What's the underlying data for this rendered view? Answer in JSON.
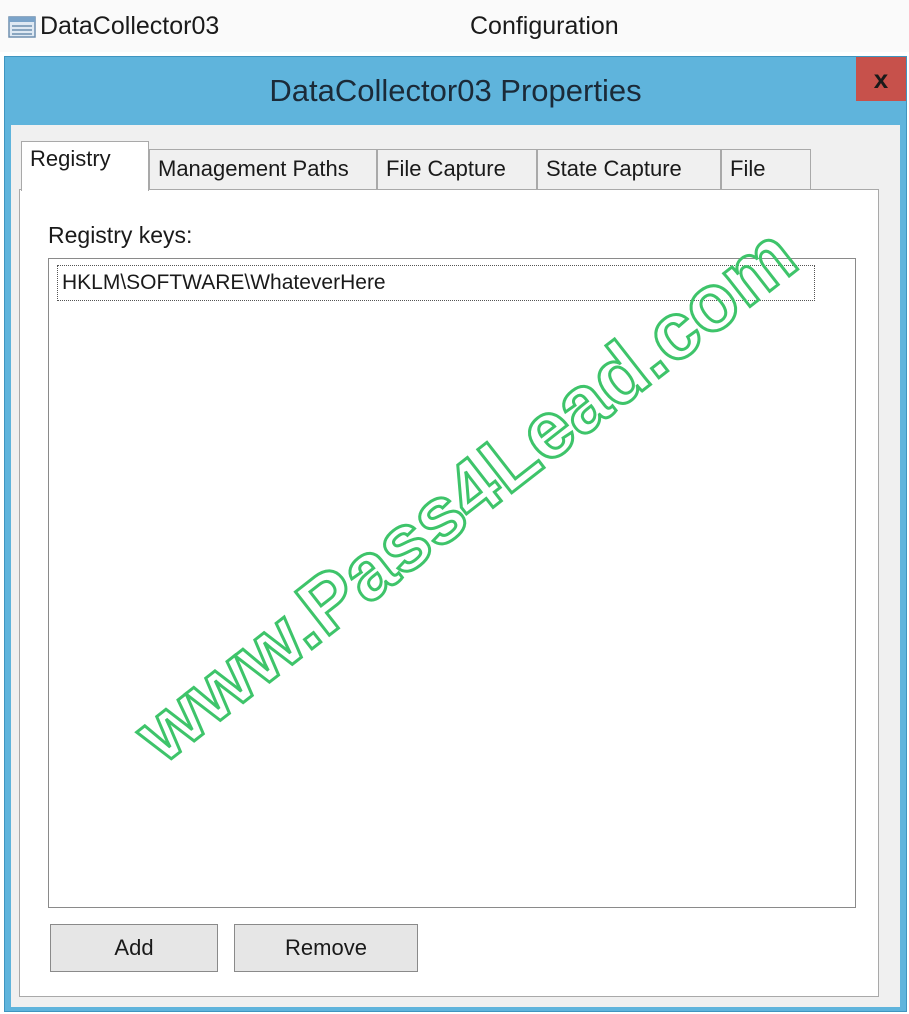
{
  "window": {
    "app_title": "DataCollector03",
    "context_label": "Configuration",
    "app_icon": "mmc-window-icon"
  },
  "dialog": {
    "title": "DataCollector03 Properties",
    "close_glyph": "x",
    "close_icon": "close-icon",
    "accent_color": "#5fb4dc"
  },
  "tabs": [
    {
      "label": "Registry",
      "active": true
    },
    {
      "label": "Management Paths",
      "active": false
    },
    {
      "label": "File Capture",
      "active": false
    },
    {
      "label": "State Capture",
      "active": false
    },
    {
      "label": "File",
      "active": false
    }
  ],
  "registry_panel": {
    "list_label": "Registry keys:",
    "keys": [
      "HKLM\\SOFTWARE\\WhateverHere"
    ],
    "add_label": "Add",
    "remove_label": "Remove"
  },
  "watermark": {
    "text": "www.Pass4Lead.com",
    "color": "#3ec46a"
  }
}
